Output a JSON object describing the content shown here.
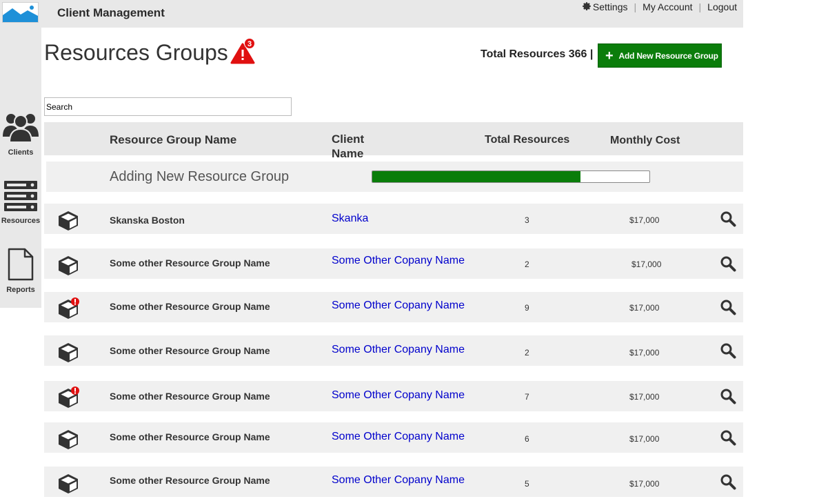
{
  "app": {
    "title": "Client Management"
  },
  "topnav": {
    "settings": "Settings",
    "account": "My Account",
    "logout": "Logout",
    "separator": "|"
  },
  "sidebar": {
    "items": [
      {
        "label": "Clients",
        "icon": "users-icon"
      },
      {
        "label": "Resources",
        "icon": "server-icon"
      },
      {
        "label": "Reports",
        "icon": "document-icon"
      }
    ]
  },
  "page": {
    "title": "Resources Groups",
    "alert_count": "3",
    "total_resources": "Total Resources 366 |",
    "add_button": "Add New Resource Group"
  },
  "search": {
    "placeholder": "Search"
  },
  "table": {
    "headers": {
      "name": "Resource Group Name",
      "client_line1": "Client",
      "client_line2": "Name",
      "total": "Total Resources",
      "cost": "Monthly Cost"
    },
    "progress": {
      "label": "Adding New Resource Group",
      "value": 0.75
    },
    "rows": [
      {
        "name": "Skanska Boston",
        "client": "Skanka",
        "total": "3",
        "cost": "$17,000",
        "alert": false
      },
      {
        "name": "Some other Resource Group Name",
        "client": "Some Other Copany Name",
        "total": "2",
        "cost": "$17,000",
        "alert": false
      },
      {
        "name": "Some other Resource Group Name",
        "client": "Some Other Copany Name",
        "total": "9",
        "cost": "$17,000",
        "alert": true
      },
      {
        "name": "Some other Resource Group Name",
        "client": "Some Other Copany Name",
        "total": "2",
        "cost": "$17,000",
        "alert": false
      },
      {
        "name": "Some other Resource Group Name",
        "client": "Some Other Copany Name",
        "total": "7",
        "cost": "$17,000",
        "alert": true
      },
      {
        "name": "Some other Resource Group Name",
        "client": "Some Other Copany Name",
        "total": "6",
        "cost": "$17,000",
        "alert": false
      },
      {
        "name": "Some other Resource Group Name",
        "client": "Some Other Copany Name",
        "total": "5",
        "cost": "$17,000",
        "alert": false
      }
    ]
  },
  "colors": {
    "accent_green": "#0b7d0b",
    "link_blue": "#0000cc",
    "alert_red": "#e01010",
    "logo_blue": "#1e90d8"
  }
}
